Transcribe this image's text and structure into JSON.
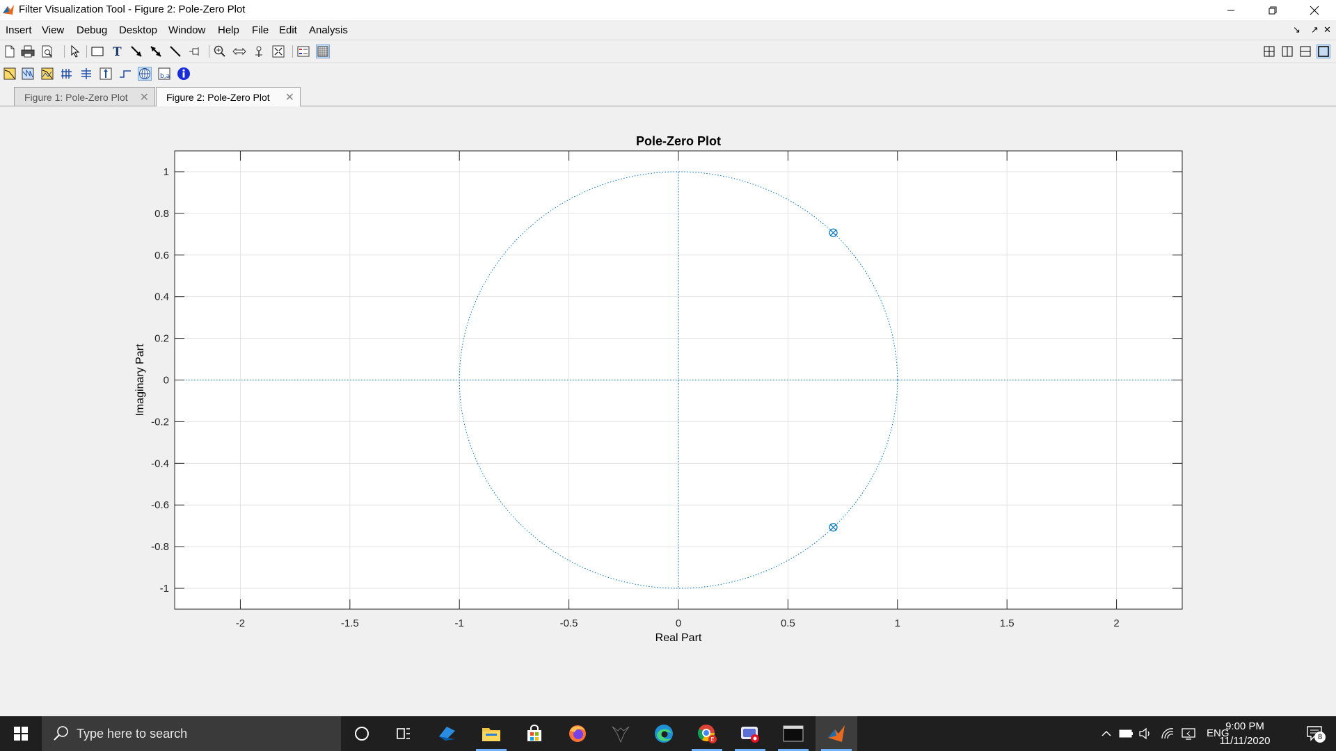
{
  "window": {
    "title": "Filter Visualization Tool - Figure 2: Pole-Zero Plot",
    "minimize_icon": "minimize-icon",
    "restore_icon": "restore-icon",
    "close_icon": "close-icon"
  },
  "menu": {
    "items": [
      {
        "label": "Insert"
      },
      {
        "label": "View"
      },
      {
        "label": "Debug"
      },
      {
        "label": "Desktop"
      },
      {
        "label": "Window"
      },
      {
        "label": "Help"
      },
      {
        "label": "File"
      },
      {
        "label": "Edit"
      },
      {
        "label": "Analysis"
      }
    ]
  },
  "toolbar1": {
    "buttons": [
      "new-icon",
      "print-icon",
      "print-preview-icon",
      "select-arrow-icon",
      "insert-rectangle-icon",
      "insert-text-icon",
      "insert-arrow-icon",
      "insert-double-arrow-icon",
      "insert-line-icon",
      "pin-icon",
      "zoom-in-icon",
      "pan-icon",
      "data-cursor-icon",
      "fit-view-icon",
      "legend-icon",
      "grid-icon"
    ],
    "layout_buttons": [
      "tile-grid-icon",
      "tile-columns-icon",
      "tile-rows-icon",
      "single-view-icon"
    ]
  },
  "toolbar2": {
    "buttons": [
      "magnitude-response-icon",
      "phase-response-icon",
      "magnitude-phase-icon",
      "group-delay-icon",
      "phase-delay-icon",
      "impulse-response-icon",
      "step-response-icon",
      "pole-zero-icon",
      "filter-coefficients-icon",
      "filter-info-icon"
    ],
    "active": "pole-zero-icon"
  },
  "tabs": [
    {
      "label": "Figure 1: Pole-Zero Plot",
      "active": false
    },
    {
      "label": "Figure 2: Pole-Zero Plot",
      "active": true
    }
  ],
  "chart_data": {
    "type": "scatter",
    "title": "Pole-Zero Plot",
    "xlabel": "Real Part",
    "ylabel": "Imaginary Part",
    "xlim": [
      -2.3,
      2.3
    ],
    "ylim": [
      -1.1,
      1.1
    ],
    "xticks": [
      -2,
      -1.5,
      -1,
      -0.5,
      0,
      0.5,
      1,
      1.5,
      2
    ],
    "xtick_labels": [
      "-2",
      "-1.5",
      "-1",
      "-0.5",
      "0",
      "0.5",
      "1",
      "1.5",
      "2"
    ],
    "yticks": [
      -1,
      -0.8,
      -0.6,
      -0.4,
      -0.2,
      0,
      0.2,
      0.4,
      0.6,
      0.8,
      1
    ],
    "ytick_labels": [
      "-1",
      "-0.8",
      "-0.6",
      "-0.4",
      "-0.2",
      "0",
      "0.2",
      "0.4",
      "0.6",
      "0.8",
      "1"
    ],
    "grid": true,
    "unit_circle": true,
    "series": [
      {
        "marker": "o",
        "x": [
          0.707,
          0.707
        ],
        "y": [
          0.707,
          -0.707
        ]
      },
      {
        "marker": "x",
        "x": [
          0.707,
          0.707
        ],
        "y": [
          0.707,
          -0.707
        ]
      }
    ],
    "color": "#0072bd"
  },
  "taskbar": {
    "search_placeholder": "Type here to search",
    "apps": [
      "cortana-icon",
      "task-view-icon",
      "edge-legacy-icon",
      "file-explorer-icon",
      "store-icon",
      "firefox-icon",
      "predator-sense-icon",
      "edge-icon",
      "chrome-icon",
      "media-app-icon",
      "terminal-icon",
      "matlab-icon"
    ],
    "active_app": "matlab-icon",
    "language": "ENG",
    "time": "9:00 PM",
    "date": "11/11/2020",
    "notification_count": "8"
  }
}
